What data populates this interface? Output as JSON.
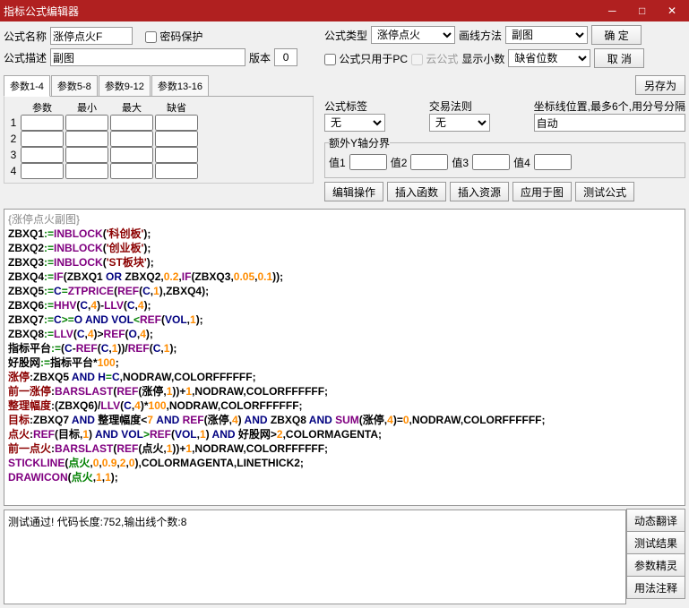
{
  "title": "指标公式编辑器",
  "labels": {
    "formulaName": "公式名称",
    "passwordProtect": "密码保护",
    "formulaDesc": "公式描述",
    "version": "版本",
    "formulaType": "公式类型",
    "drawMethod": "画线方法",
    "pcOnly": "公式只用于PC",
    "cloudFormula": "云公式",
    "showDecimal": "显示小数",
    "formulaTag": "公式标签",
    "tradeRule": "交易法则",
    "coordPos": "坐标线位置,最多6个,用分号分隔",
    "extraYAxis": "额外Y轴分界",
    "val1": "值1",
    "val2": "值2",
    "val3": "值3",
    "val4": "值4"
  },
  "values": {
    "formulaName": "涨停点火F",
    "formulaDesc": "副图",
    "version": "0",
    "formulaType": "涨停点火",
    "drawMethod": "副图",
    "showDecimal": "缺省位数",
    "formulaTag": "无",
    "tradeRule": "无",
    "coordPos": "自动"
  },
  "buttons": {
    "ok": "确  定",
    "cancel": "取  消",
    "saveAs": "另存为",
    "editOp": "编辑操作",
    "insertFunc": "插入函数",
    "insertRes": "插入资源",
    "applyChart": "应用于图",
    "testFormula": "测试公式",
    "dynTrans": "动态翻译",
    "testResult": "测试结果",
    "paramWiz": "参数精灵",
    "usageNote": "用法注释"
  },
  "tabs": [
    "参数1-4",
    "参数5-8",
    "参数9-12",
    "参数13-16"
  ],
  "paramHeaders": [
    "参数",
    "最小",
    "最大",
    "缺省"
  ],
  "statusText": "测试通过! 代码长度:752,输出线个数:8",
  "codeHeader": "{涨停点火副图}",
  "codeLines": [
    [
      [
        "ZBXQ1",
        0
      ],
      [
        ":=",
        1
      ],
      [
        "INBLOCK",
        2
      ],
      [
        "(",
        0
      ],
      [
        "'科创板'",
        3
      ],
      [
        ");",
        0
      ]
    ],
    [
      [
        "ZBXQ2",
        0
      ],
      [
        ":=",
        1
      ],
      [
        "INBLOCK",
        2
      ],
      [
        "(",
        0
      ],
      [
        "'创业板'",
        3
      ],
      [
        ");",
        0
      ]
    ],
    [
      [
        "ZBXQ3",
        0
      ],
      [
        ":=",
        1
      ],
      [
        "INBLOCK",
        2
      ],
      [
        "(",
        0
      ],
      [
        "'ST板块'",
        3
      ],
      [
        ");",
        0
      ]
    ],
    [
      [
        "ZBXQ4",
        0
      ],
      [
        ":=",
        1
      ],
      [
        "IF",
        2
      ],
      [
        "(ZBXQ1 ",
        0
      ],
      [
        "OR",
        5
      ],
      [
        " ZBXQ2,",
        0
      ],
      [
        "0.2",
        4
      ],
      [
        ",",
        0
      ],
      [
        "IF",
        2
      ],
      [
        "(ZBXQ3,",
        0
      ],
      [
        "0.05",
        4
      ],
      [
        ",",
        0
      ],
      [
        "0.1",
        4
      ],
      [
        "));",
        0
      ]
    ],
    [
      [
        "ZBXQ5",
        0
      ],
      [
        ":=",
        1
      ],
      [
        "C",
        5
      ],
      [
        "=",
        1
      ],
      [
        "ZTPRICE",
        2
      ],
      [
        "(",
        0
      ],
      [
        "REF",
        2
      ],
      [
        "(",
        0
      ],
      [
        "C",
        5
      ],
      [
        ",",
        0
      ],
      [
        "1",
        4
      ],
      [
        "),ZBXQ4);",
        0
      ]
    ],
    [
      [
        "ZBXQ6",
        0
      ],
      [
        ":=",
        1
      ],
      [
        "HHV",
        2
      ],
      [
        "(",
        0
      ],
      [
        "C",
        5
      ],
      [
        ",",
        0
      ],
      [
        "4",
        4
      ],
      [
        ")-",
        0
      ],
      [
        "LLV",
        2
      ],
      [
        "(",
        0
      ],
      [
        "C",
        5
      ],
      [
        ",",
        0
      ],
      [
        "4",
        4
      ],
      [
        ");",
        0
      ]
    ],
    [
      [
        "ZBXQ7",
        0
      ],
      [
        ":=",
        1
      ],
      [
        "C",
        5
      ],
      [
        ">=",
        1
      ],
      [
        "O",
        5
      ],
      [
        " AND ",
        5
      ],
      [
        "VOL",
        5
      ],
      [
        "<",
        1
      ],
      [
        "REF",
        2
      ],
      [
        "(",
        0
      ],
      [
        "VOL",
        5
      ],
      [
        ",",
        0
      ],
      [
        "1",
        4
      ],
      [
        ");",
        0
      ]
    ],
    [
      [
        "ZBXQ8",
        0
      ],
      [
        ":=",
        1
      ],
      [
        "LLV",
        2
      ],
      [
        "(",
        0
      ],
      [
        "C",
        5
      ],
      [
        ",",
        0
      ],
      [
        "4",
        4
      ],
      [
        ")>",
        0
      ],
      [
        "REF",
        2
      ],
      [
        "(",
        0
      ],
      [
        "O",
        5
      ],
      [
        ",",
        0
      ],
      [
        "4",
        4
      ],
      [
        ");",
        0
      ]
    ],
    [
      [
        "指标平台",
        0
      ],
      [
        ":=",
        1
      ],
      [
        "(",
        0
      ],
      [
        "C",
        5
      ],
      [
        "-",
        0
      ],
      [
        "REF",
        2
      ],
      [
        "(",
        0
      ],
      [
        "C",
        5
      ],
      [
        ",",
        0
      ],
      [
        "1",
        4
      ],
      [
        "))/",
        0
      ],
      [
        "REF",
        2
      ],
      [
        "(",
        0
      ],
      [
        "C",
        5
      ],
      [
        ",",
        0
      ],
      [
        "1",
        4
      ],
      [
        ");",
        0
      ]
    ],
    [
      [
        "好股网",
        0
      ],
      [
        ":=",
        1
      ],
      [
        "指标平台*",
        0
      ],
      [
        "100",
        4
      ],
      [
        ";",
        0
      ]
    ],
    [
      [
        "涨停",
        3
      ],
      [
        ":ZBXQ5 ",
        0
      ],
      [
        "AND H",
        5
      ],
      [
        "=",
        1
      ],
      [
        "C",
        5
      ],
      [
        ",NODRAW,COLORFFFFFF;",
        0
      ]
    ],
    [
      [
        "前一涨停",
        3
      ],
      [
        ":",
        0
      ],
      [
        "BARSLAST",
        2
      ],
      [
        "(",
        0
      ],
      [
        "REF",
        2
      ],
      [
        "(涨停,",
        0
      ],
      [
        "1",
        4
      ],
      [
        "))+",
        0
      ],
      [
        "1",
        4
      ],
      [
        ",NODRAW,COLORFFFFFF;",
        0
      ]
    ],
    [
      [
        "整理幅度",
        3
      ],
      [
        ":(ZBXQ6)/",
        0
      ],
      [
        "LLV",
        2
      ],
      [
        "(",
        0
      ],
      [
        "C",
        5
      ],
      [
        ",",
        0
      ],
      [
        "4",
        4
      ],
      [
        ")*",
        0
      ],
      [
        "100",
        4
      ],
      [
        ",NODRAW,COLORFFFFFF;",
        0
      ]
    ],
    [
      [
        "目标",
        3
      ],
      [
        ":ZBXQ7 ",
        0
      ],
      [
        "AND",
        5
      ],
      [
        " 整理幅度<",
        0
      ],
      [
        "7",
        4
      ],
      [
        " AND ",
        5
      ],
      [
        "REF",
        2
      ],
      [
        "(涨停,",
        0
      ],
      [
        "4",
        4
      ],
      [
        ") ",
        0
      ],
      [
        "AND",
        5
      ],
      [
        " ZBXQ8 ",
        0
      ],
      [
        "AND ",
        5
      ],
      [
        "SUM",
        2
      ],
      [
        "(涨停,",
        0
      ],
      [
        "4",
        4
      ],
      [
        ")=",
        0
      ],
      [
        "0",
        4
      ],
      [
        ",NODRAW,COLORFFFFFF;",
        0
      ]
    ],
    [
      [
        "点火",
        3
      ],
      [
        ":",
        0
      ],
      [
        "REF",
        2
      ],
      [
        "(目标,",
        0
      ],
      [
        "1",
        4
      ],
      [
        ") ",
        0
      ],
      [
        "AND VOL",
        5
      ],
      [
        ">",
        1
      ],
      [
        "REF",
        2
      ],
      [
        "(",
        0
      ],
      [
        "VOL",
        5
      ],
      [
        ",",
        0
      ],
      [
        "1",
        4
      ],
      [
        ") ",
        0
      ],
      [
        "AND",
        5
      ],
      [
        " 好股网>",
        0
      ],
      [
        "2",
        4
      ],
      [
        ",COLORMAGENTA;",
        0
      ]
    ],
    [
      [
        "前一点火",
        3
      ],
      [
        ":",
        0
      ],
      [
        "BARSLAST",
        2
      ],
      [
        "(",
        0
      ],
      [
        "REF",
        2
      ],
      [
        "(点火,",
        0
      ],
      [
        "1",
        4
      ],
      [
        "))+",
        0
      ],
      [
        "1",
        4
      ],
      [
        ",NODRAW,COLORFFFFFF;",
        0
      ]
    ],
    [
      [
        "STICKLINE",
        2
      ],
      [
        "(",
        0
      ],
      [
        "点火",
        1
      ],
      [
        ",",
        0
      ],
      [
        "0",
        4
      ],
      [
        ",",
        0
      ],
      [
        "0.9",
        4
      ],
      [
        ",",
        0
      ],
      [
        "2",
        4
      ],
      [
        ",",
        0
      ],
      [
        "0",
        4
      ],
      [
        "),COLORMAGENTA,LINETHICK2;",
        0
      ]
    ],
    [
      [
        "DRAWICON",
        2
      ],
      [
        "(",
        0
      ],
      [
        "点火",
        1
      ],
      [
        ",",
        0
      ],
      [
        "1",
        4
      ],
      [
        ",",
        0
      ],
      [
        "1",
        4
      ],
      [
        ");",
        0
      ]
    ]
  ]
}
